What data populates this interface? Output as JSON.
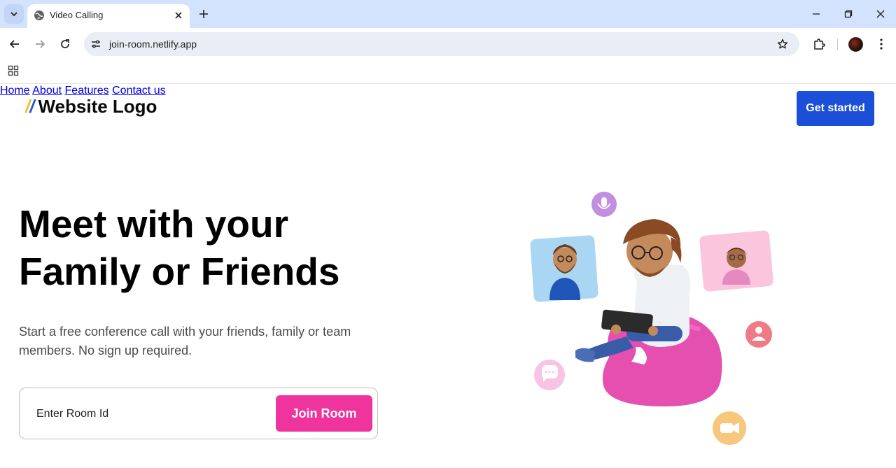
{
  "browser": {
    "tab_title": "Video Calling",
    "url": "join-room.netlify.app"
  },
  "header": {
    "logo_mark": "//",
    "logo_text": "Website Logo",
    "nav": [
      "Home",
      "About",
      "Features",
      "Contact us"
    ],
    "cta_label": "Get started"
  },
  "hero": {
    "title_line1": "Meet with your",
    "title_line2": "Family or Friends",
    "subtitle": "Start a free conference call with your friends, family or team members. No sign up required.",
    "room_placeholder": "Enter Room Id",
    "join_label": "Join Room"
  },
  "colors": {
    "accent_blue": "#1c4fd8",
    "accent_pink": "#f0349d",
    "logo_yellow": "#f4c01e"
  },
  "illustration_icons": [
    "microphone-icon",
    "user-icon",
    "chat-icon",
    "video-camera-icon"
  ]
}
